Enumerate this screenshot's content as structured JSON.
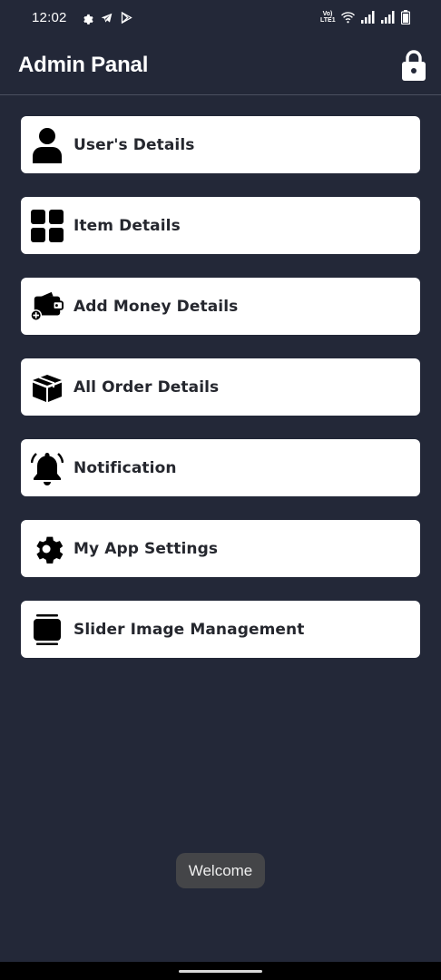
{
  "status_bar": {
    "time": "12:02",
    "left_icons": [
      "gear-icon",
      "telegram-icon",
      "play-store-icon"
    ],
    "network_label": "Vo) LTE1",
    "right_icons": [
      "volte-icon",
      "wifi-icon",
      "signal-icon",
      "signal-icon",
      "battery-icon"
    ]
  },
  "header": {
    "title": "Admin Panal",
    "action_icon": "lock-icon"
  },
  "menu": {
    "items": [
      {
        "label": "User's Details",
        "icon": "user-icon"
      },
      {
        "label": "Item Details",
        "icon": "grid-icon"
      },
      {
        "label": "Add Money Details",
        "icon": "wallet-add-icon"
      },
      {
        "label": "All Order Details",
        "icon": "box-icon"
      },
      {
        "label": "Notification",
        "icon": "bell-icon"
      },
      {
        "label": "My App Settings",
        "icon": "gear-icon"
      },
      {
        "label": "Slider Image Management",
        "icon": "slider-icon"
      }
    ]
  },
  "toast": {
    "text": "Welcome"
  },
  "colors": {
    "background": "#232838",
    "card": "#ffffff",
    "text_dark": "#25272e",
    "toast_bg": "#444548"
  }
}
